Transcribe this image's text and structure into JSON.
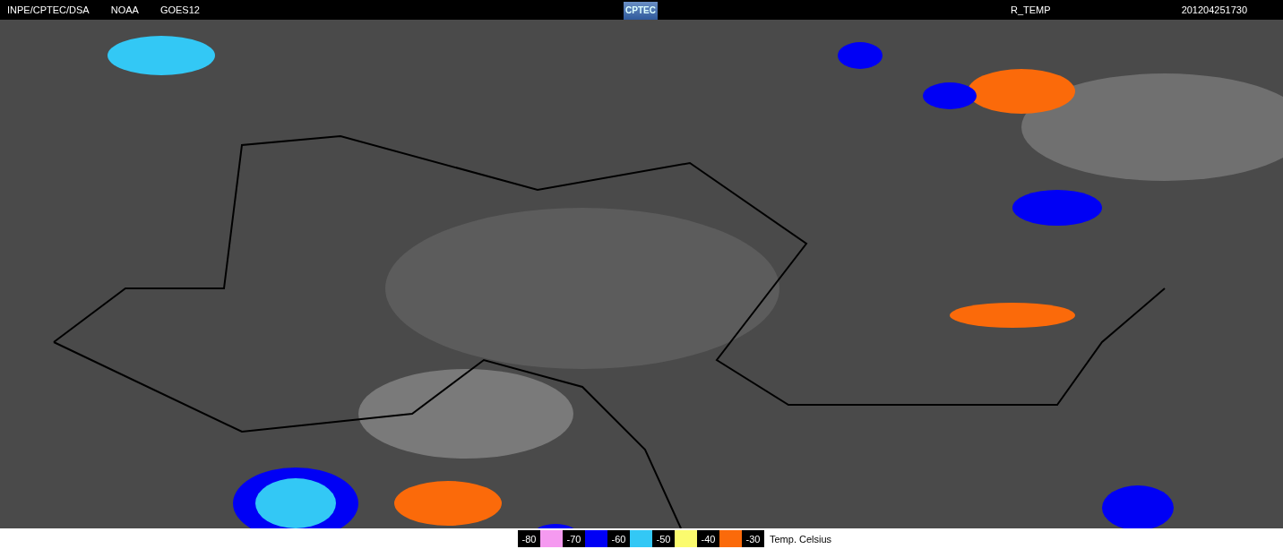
{
  "header": {
    "sources": [
      "INPE/CPTEC/DSA",
      "NOAA",
      "GOES12"
    ],
    "logo": "CPTEC",
    "product": "R_TEMP",
    "timestamp": "201204251730"
  },
  "legend": {
    "items": [
      {
        "label": "-80",
        "color": "#f59af0"
      },
      {
        "label": "-70",
        "color": "#0000f5"
      },
      {
        "label": "-60",
        "color": "#33c8f5"
      },
      {
        "label": "-50",
        "color": "#fbfb6e"
      },
      {
        "label": "-40",
        "color": "#fb6a0a"
      },
      {
        "label": "-30"
      }
    ],
    "unit": "Temp. Celsius"
  }
}
